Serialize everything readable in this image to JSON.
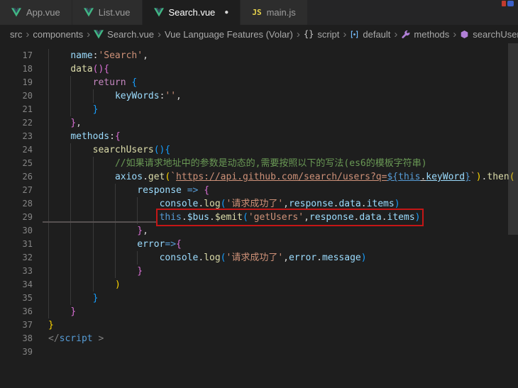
{
  "palette": {
    "prop": "#9cdcfe",
    "str": "#ce9178",
    "kw": "#c586c0",
    "kwb": "#569cd6",
    "fn": "#dcdcaa",
    "cm": "#6a9955",
    "pn": "#d4d4d4",
    "b1": "#ffd700",
    "b2": "#da70d6",
    "b3": "#179fff",
    "tagpn": "#808080"
  },
  "colors": {
    "editor_bg": "#1e1e1e",
    "tabbar_bg": "#252526",
    "tab_inactive_bg": "#2d2d2d",
    "tab_active_bg": "#1e1e1e",
    "line_number": "#858585",
    "breadcrumb_text": "#a9a9a9",
    "highlight_box": "#c41616"
  },
  "tabs": [
    {
      "label": "App.vue",
      "icon": "vue",
      "active": false,
      "modified": false
    },
    {
      "label": "List.vue",
      "icon": "vue",
      "active": false,
      "modified": false
    },
    {
      "label": "Search.vue",
      "icon": "vue",
      "active": true,
      "modified": true
    },
    {
      "label": "main.js",
      "icon": "js",
      "active": false,
      "modified": false
    }
  ],
  "breadcrumb": [
    {
      "label": "src"
    },
    {
      "label": "components"
    },
    {
      "label": "Search.vue",
      "icon": "vue"
    },
    {
      "label": "Vue Language Features (Volar)"
    },
    {
      "label": "script",
      "icon": "braces"
    },
    {
      "label": "default",
      "icon": "bracket-dot"
    },
    {
      "label": "methods",
      "icon": "wrench"
    },
    {
      "label": "searchUsers",
      "icon": "method"
    }
  ],
  "editor": {
    "lines": [
      {
        "num": "17",
        "indent": 1,
        "tokens": [
          {
            "t": "name",
            "s": "prop"
          },
          {
            "t": ":",
            "s": "pn"
          },
          {
            "t": "'Search'",
            "s": "str"
          },
          {
            "t": ",",
            "s": "pn"
          }
        ]
      },
      {
        "num": "18",
        "indent": 1,
        "tokens": [
          {
            "t": "data",
            "s": "fn"
          },
          {
            "t": "(",
            "s": "b2"
          },
          {
            "t": ")",
            "s": "b2"
          },
          {
            "t": "{",
            "s": "b2"
          }
        ]
      },
      {
        "num": "19",
        "indent": 2,
        "tokens": [
          {
            "t": "return",
            "s": "kw"
          },
          {
            "t": " ",
            "s": "pn"
          },
          {
            "t": "{",
            "s": "b3"
          }
        ]
      },
      {
        "num": "20",
        "indent": 3,
        "tokens": [
          {
            "t": "keyWords",
            "s": "prop"
          },
          {
            "t": ":",
            "s": "pn"
          },
          {
            "t": "''",
            "s": "str"
          },
          {
            "t": ",",
            "s": "pn"
          }
        ]
      },
      {
        "num": "21",
        "indent": 2,
        "tokens": [
          {
            "t": "}",
            "s": "b3"
          }
        ]
      },
      {
        "num": "22",
        "indent": 1,
        "tokens": [
          {
            "t": "}",
            "s": "b2"
          },
          {
            "t": ",",
            "s": "pn"
          }
        ]
      },
      {
        "num": "23",
        "indent": 1,
        "tokens": [
          {
            "t": "methods",
            "s": "prop"
          },
          {
            "t": ":",
            "s": "pn"
          },
          {
            "t": "{",
            "s": "b2"
          }
        ]
      },
      {
        "num": "24",
        "indent": 2,
        "tokens": [
          {
            "t": "searchUsers",
            "s": "fn"
          },
          {
            "t": "(",
            "s": "b3"
          },
          {
            "t": ")",
            "s": "b3"
          },
          {
            "t": "{",
            "s": "b3"
          }
        ]
      },
      {
        "num": "25",
        "indent": 3,
        "tokens": [
          {
            "t": "//如果请求地址中的参数是动态的,需要按照以下的写法(es6的模板字符串)",
            "s": "cm"
          }
        ]
      },
      {
        "num": "26",
        "indent": 3,
        "tokens": [
          {
            "t": "axios",
            "s": "prop"
          },
          {
            "t": ".",
            "s": "pn"
          },
          {
            "t": "get",
            "s": "fn"
          },
          {
            "t": "(",
            "s": "b1"
          },
          {
            "t": "`",
            "s": "str"
          },
          {
            "t": "https://api.github.com/search/users?q=",
            "s": "str",
            "u": true
          },
          {
            "t": "${",
            "s": "kwb",
            "u": true
          },
          {
            "t": "this",
            "s": "kwb",
            "u": true
          },
          {
            "t": ".",
            "s": "pn",
            "u": true
          },
          {
            "t": "keyWord",
            "s": "prop",
            "u": true
          },
          {
            "t": "}",
            "s": "kwb",
            "u": true
          },
          {
            "t": "`",
            "s": "str"
          },
          {
            "t": ")",
            "s": "b1"
          },
          {
            "t": ".",
            "s": "pn"
          },
          {
            "t": "then",
            "s": "fn"
          },
          {
            "t": "(",
            "s": "b1"
          }
        ]
      },
      {
        "num": "27",
        "indent": 4,
        "tokens": [
          {
            "t": "response",
            "s": "prop"
          },
          {
            "t": " ",
            "s": "pn"
          },
          {
            "t": "=>",
            "s": "kwb"
          },
          {
            "t": " ",
            "s": "pn"
          },
          {
            "t": "{",
            "s": "b2"
          }
        ]
      },
      {
        "num": "28",
        "indent": 5,
        "tokens": [
          {
            "t": "console",
            "s": "prop"
          },
          {
            "t": ".",
            "s": "pn"
          },
          {
            "t": "log",
            "s": "fn"
          },
          {
            "t": "(",
            "s": "b3"
          },
          {
            "t": "'请求成功了'",
            "s": "str"
          },
          {
            "t": ",",
            "s": "pn"
          },
          {
            "t": "response",
            "s": "prop"
          },
          {
            "t": ".",
            "s": "pn"
          },
          {
            "t": "data",
            "s": "prop"
          },
          {
            "t": ".",
            "s": "pn"
          },
          {
            "t": "items",
            "s": "prop"
          },
          {
            "t": ")",
            "s": "b3"
          }
        ]
      },
      {
        "num": "29",
        "indent": 5,
        "boxed": true,
        "tokens": [
          {
            "t": "this",
            "s": "kwb"
          },
          {
            "t": ".",
            "s": "pn"
          },
          {
            "t": "$bus",
            "s": "prop"
          },
          {
            "t": ".",
            "s": "pn"
          },
          {
            "t": "$emit",
            "s": "fn"
          },
          {
            "t": "(",
            "s": "b3"
          },
          {
            "t": "'getUsers'",
            "s": "str"
          },
          {
            "t": ",",
            "s": "pn"
          },
          {
            "t": "response",
            "s": "prop"
          },
          {
            "t": ".",
            "s": "pn"
          },
          {
            "t": "data",
            "s": "prop"
          },
          {
            "t": ".",
            "s": "pn"
          },
          {
            "t": "items",
            "s": "prop"
          },
          {
            "t": ")",
            "s": "b3"
          }
        ]
      },
      {
        "num": "30",
        "indent": 4,
        "tokens": [
          {
            "t": "}",
            "s": "b2"
          },
          {
            "t": ",",
            "s": "pn"
          }
        ]
      },
      {
        "num": "31",
        "indent": 4,
        "tokens": [
          {
            "t": "error",
            "s": "prop"
          },
          {
            "t": "=>",
            "s": "kwb"
          },
          {
            "t": "{",
            "s": "b2"
          }
        ]
      },
      {
        "num": "32",
        "indent": 5,
        "tokens": [
          {
            "t": "console",
            "s": "prop"
          },
          {
            "t": ".",
            "s": "pn"
          },
          {
            "t": "log",
            "s": "fn"
          },
          {
            "t": "(",
            "s": "b3"
          },
          {
            "t": "'请求成功了'",
            "s": "str"
          },
          {
            "t": ",",
            "s": "pn"
          },
          {
            "t": "error",
            "s": "prop"
          },
          {
            "t": ".",
            "s": "pn"
          },
          {
            "t": "message",
            "s": "prop"
          },
          {
            "t": ")",
            "s": "b3"
          }
        ]
      },
      {
        "num": "33",
        "indent": 4,
        "tokens": [
          {
            "t": "}",
            "s": "b2"
          }
        ]
      },
      {
        "num": "34",
        "indent": 3,
        "tokens": [
          {
            "t": ")",
            "s": "b1"
          }
        ]
      },
      {
        "num": "35",
        "indent": 2,
        "tokens": [
          {
            "t": "}",
            "s": "b3"
          }
        ]
      },
      {
        "num": "36",
        "indent": 1,
        "tokens": [
          {
            "t": "}",
            "s": "b2"
          }
        ]
      },
      {
        "num": "37",
        "indent": 0,
        "tokens": [
          {
            "t": "}",
            "s": "b1"
          }
        ]
      },
      {
        "num": "38",
        "indent": 0,
        "tokens": [
          {
            "t": "</",
            "s": "tagpn"
          },
          {
            "t": "script",
            "s": "kwb"
          },
          {
            "t": " >",
            "s": "tagpn"
          }
        ]
      },
      {
        "num": "39",
        "indent": 0,
        "tokens": []
      }
    ]
  }
}
